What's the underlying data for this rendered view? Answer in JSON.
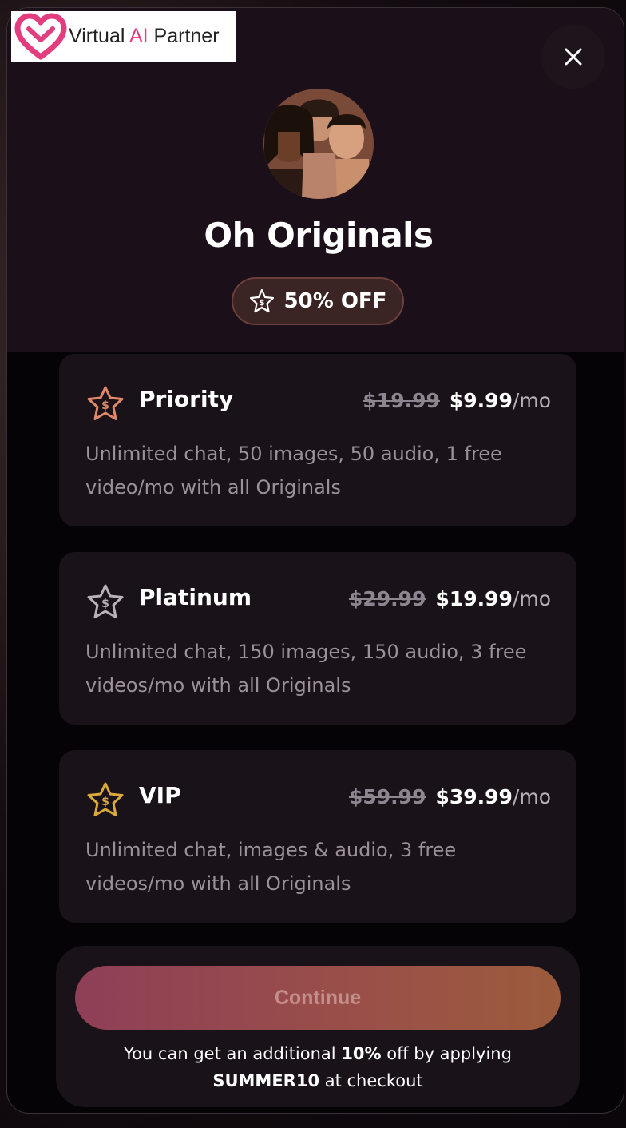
{
  "logo": {
    "text_main": "Virtual ",
    "text_accent": "AI",
    "text_end": " Partner"
  },
  "header": {
    "close_label": "×",
    "title": "Oh Originals",
    "discount": "50% OFF"
  },
  "plans": [
    {
      "name": "Priority",
      "old_price": "$19.99",
      "new_price": "$9.99",
      "period": "/mo",
      "description": "Unlimited chat, 50 images, 50 audio, 1 free video/mo with all Originals",
      "icon": "star-dollar-icon",
      "icon_color": "#e0896a"
    },
    {
      "name": "Platinum",
      "old_price": "$29.99",
      "new_price": "$19.99",
      "period": "/mo",
      "description": "Unlimited chat, 150 images, 150 audio, 3 free videos/mo with all Originals",
      "icon": "star-dollar-icon",
      "icon_color": "#b9b3b8"
    },
    {
      "name": "VIP",
      "old_price": "$59.99",
      "new_price": "$39.99",
      "period": "/mo",
      "description": "Unlimited chat, images & audio, 3 free videos/mo with all Originals",
      "icon": "star-dollar-icon",
      "icon_color": "#d9a93a"
    }
  ],
  "footer": {
    "continue_label": "Continue",
    "promo_prefix": "You can get an additional ",
    "promo_discount": "10%",
    "promo_middle": " off by applying ",
    "promo_code": "SUMMER10",
    "promo_suffix": " at checkout"
  },
  "colors": {
    "accent_pink": "#e23d7f",
    "button_start": "#8f3f57",
    "button_end": "#9c5b3c",
    "card_bg": "#1a1219"
  }
}
